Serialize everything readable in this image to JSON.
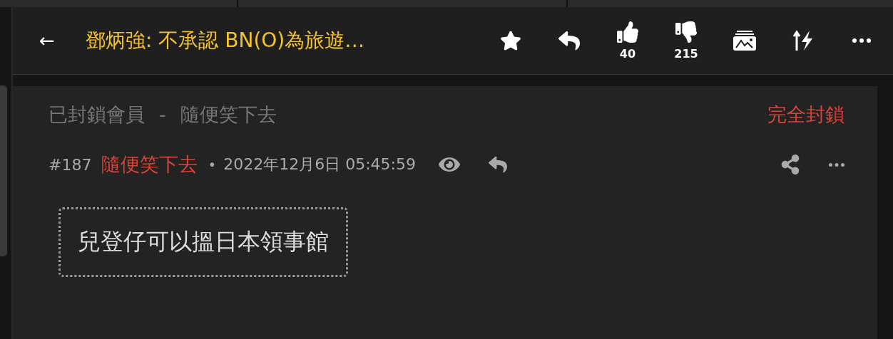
{
  "header": {
    "back": "←",
    "title": "鄧炳強: 不承認 BN(O)為旅遊…",
    "likes": "40",
    "dislikes": "215"
  },
  "blocked_banner": {
    "label": "已封鎖會員",
    "separator": "-",
    "name": "隨便笑下去",
    "action": "完全封鎖"
  },
  "post": {
    "number": "#187",
    "author": "隨便笑下去",
    "bullet": "•",
    "date": "2022年12月6日 05:45:59",
    "body": "兒登仔可以搵日本領事館"
  }
}
